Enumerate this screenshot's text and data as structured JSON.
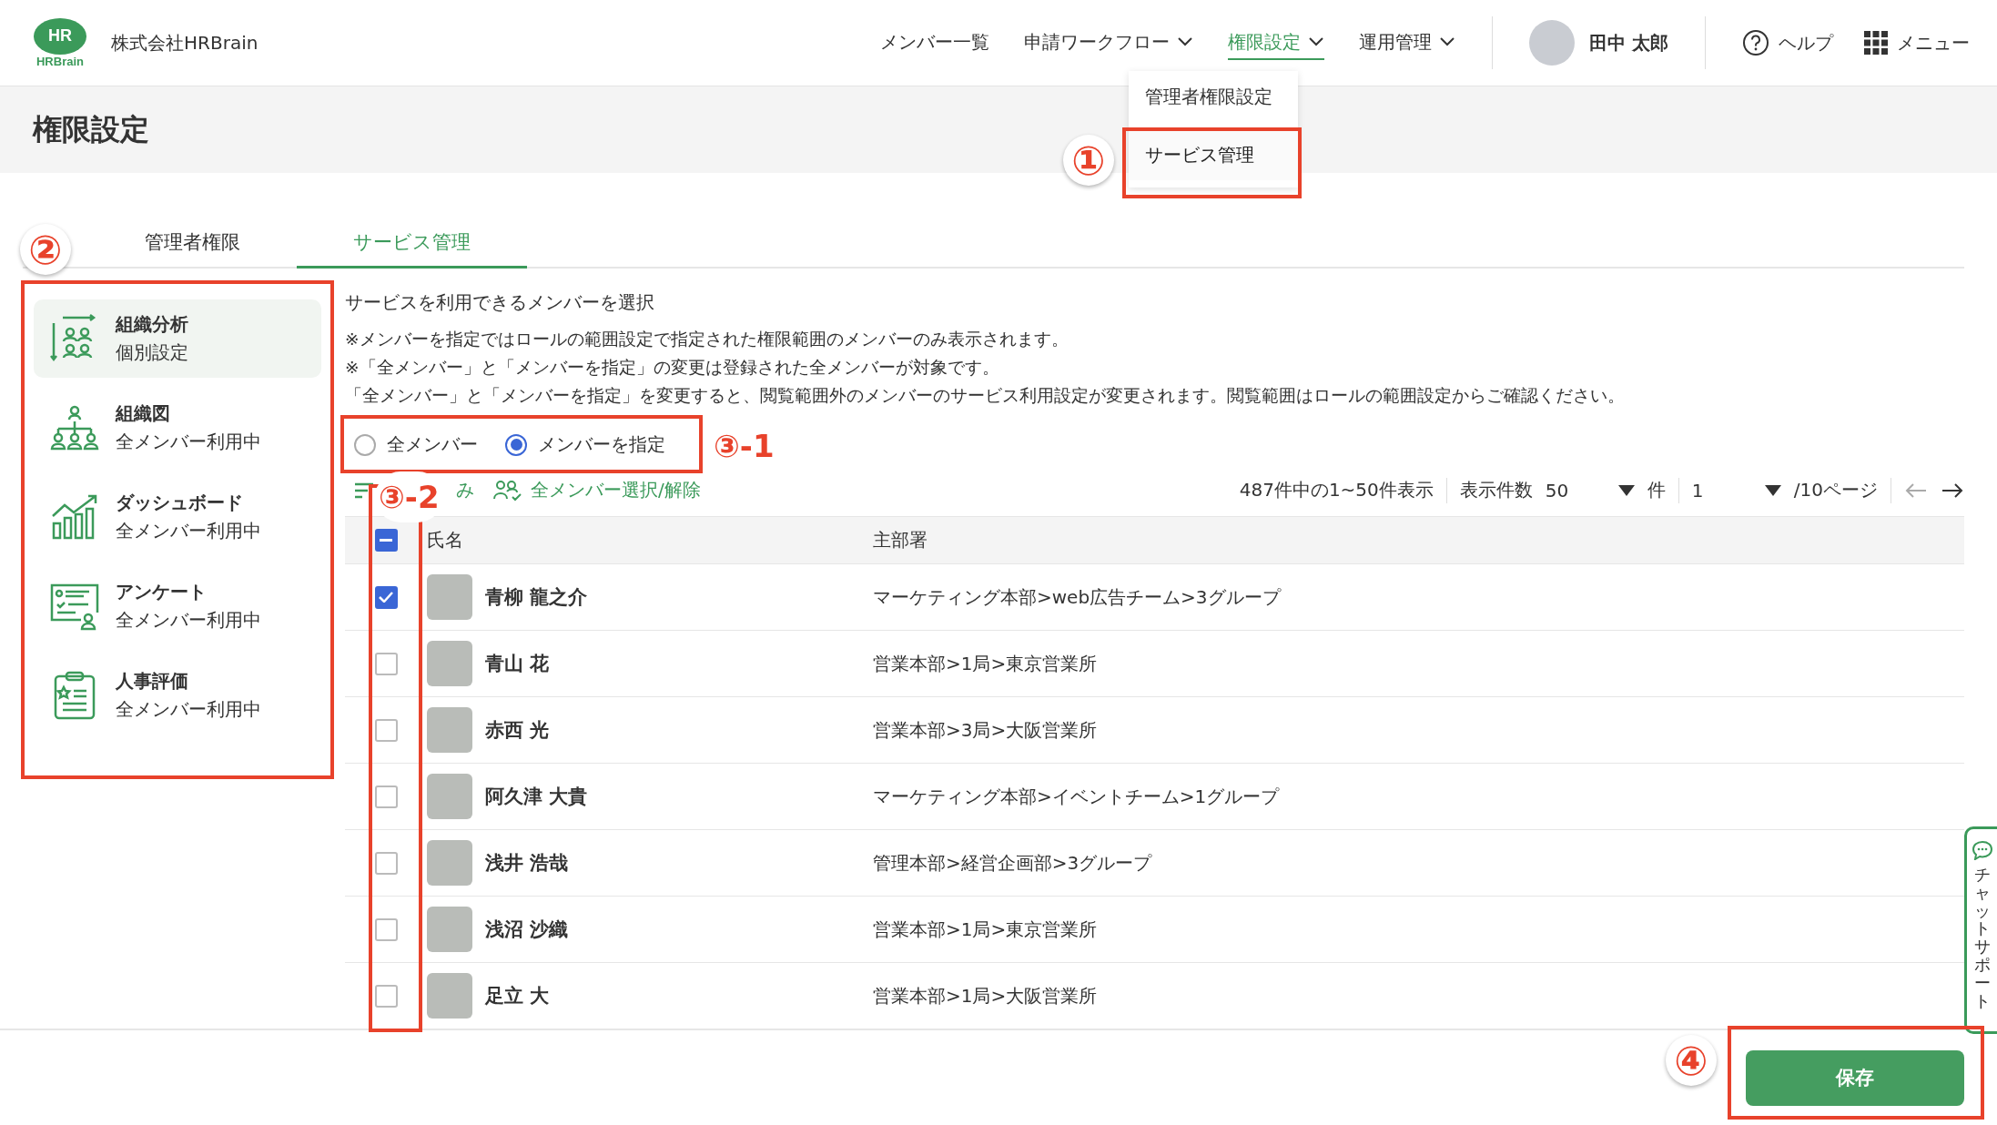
{
  "header": {
    "logo": {
      "mark": "HR",
      "wordmark": "HRBrain"
    },
    "company": "株式会社HRBrain",
    "nav": [
      {
        "label": "メンバー一覧",
        "dropdown": false,
        "selected": false
      },
      {
        "label": "申請ワークフロー",
        "dropdown": true,
        "selected": false
      },
      {
        "label": "権限設定",
        "dropdown": true,
        "selected": true
      },
      {
        "label": "運用管理",
        "dropdown": true,
        "selected": false
      }
    ],
    "user": "田中 太郎",
    "help": "ヘルプ",
    "menu": "メニュー"
  },
  "dropdown_menu": {
    "items": [
      {
        "label": "管理者権限設定",
        "selected": false
      },
      {
        "label": "サービス管理",
        "selected": true
      }
    ]
  },
  "page_title": "権限設定",
  "tabs": [
    {
      "label": "管理者権限",
      "selected": false
    },
    {
      "label": "サービス管理",
      "selected": true
    }
  ],
  "sidebar": {
    "items": [
      {
        "kind": "analysis",
        "title": "組織分析",
        "status": "個別設定",
        "selected": true
      },
      {
        "kind": "org",
        "title": "組織図",
        "status": "全メンバー利用中",
        "selected": false
      },
      {
        "kind": "dashboard",
        "title": "ダッシュボード",
        "status": "全メンバー利用中",
        "selected": false
      },
      {
        "kind": "survey",
        "title": "アンケート",
        "status": "全メンバー利用中",
        "selected": false
      },
      {
        "kind": "evaluation",
        "title": "人事評価",
        "status": "全メンバー利用中",
        "selected": false
      }
    ]
  },
  "content": {
    "heading": "サービスを利用できるメンバーを選択",
    "notes": [
      "※メンバーを指定ではロールの範囲設定で指定された権限範囲のメンバーのみ表示されます。",
      "※「全メンバー」と「メンバーを指定」の変更は登録された全メンバーが対象です。",
      "「全メンバー」と「メンバーを指定」を変更すると、閲覧範囲外のメンバーのサービス利用設定が変更されます。閲覧範囲はロールの範囲設定からご確認ください。"
    ],
    "radios": [
      {
        "label": "全メンバー",
        "selected": false
      },
      {
        "label": "メンバーを指定",
        "selected": true
      }
    ],
    "toolbar": {
      "filter": "み",
      "select_all": "全メンバー選択/解除",
      "count": "487件中の1~50件表示",
      "per_page_label": "表示件数",
      "per_page": "50",
      "per_page_unit": "件",
      "page": "1",
      "page_total": "/10ページ"
    }
  },
  "table": {
    "columns": [
      "氏名",
      "主部署"
    ],
    "header_checkbox": {
      "checked": true,
      "indeterminate": true
    },
    "rows": [
      {
        "name": "青柳 龍之介",
        "department": "マーケティング本部>web広告チーム>3グループ",
        "checked": true
      },
      {
        "name": "青山 花",
        "department": "営業本部>1局>東京営業所",
        "checked": false
      },
      {
        "name": "赤西 光",
        "department": "営業本部>3局>大阪営業所",
        "checked": false
      },
      {
        "name": "阿久津 大貴",
        "department": "マーケティング本部>イベントチーム>1グループ",
        "checked": false
      },
      {
        "name": "浅井 浩哉",
        "department": "管理本部>経営企画部>3グループ",
        "checked": false
      },
      {
        "name": "浅沼 沙織",
        "department": "営業本部>1局>東京営業所",
        "checked": false
      },
      {
        "name": "足立 大",
        "department": "営業本部>1局>大阪営業所",
        "checked": false
      }
    ]
  },
  "save_button": "保存",
  "chat_support": "チャットサポート",
  "annotations": [
    "①",
    "②",
    "③-1",
    "③-2",
    "④"
  ]
}
